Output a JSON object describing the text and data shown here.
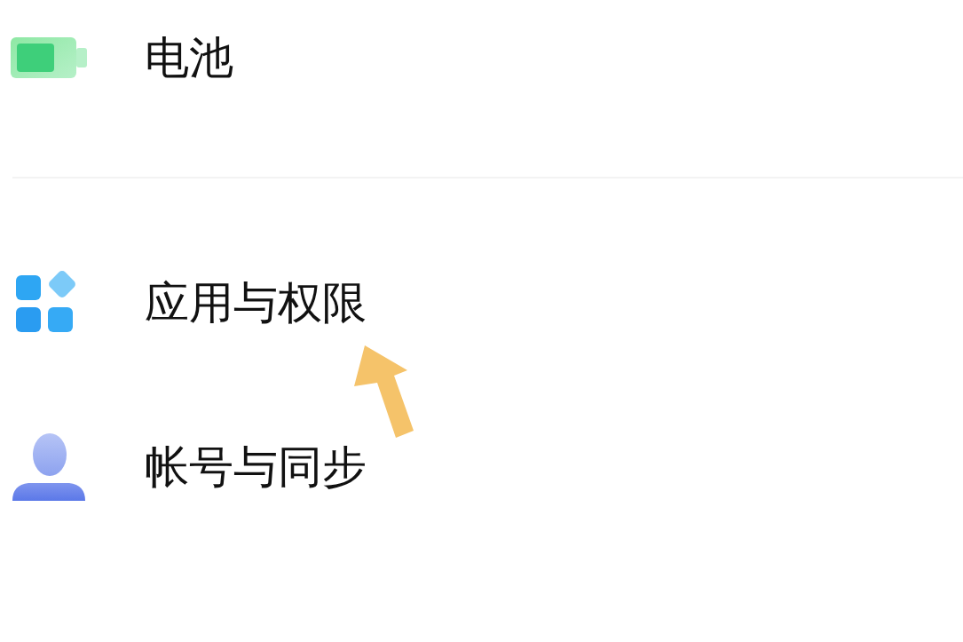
{
  "sections": [
    {
      "items": [
        {
          "kind": "battery",
          "label": "电池"
        }
      ]
    },
    {
      "items": [
        {
          "kind": "apps",
          "label": "应用与权限"
        },
        {
          "kind": "account",
          "label": "帐号与同步"
        }
      ]
    }
  ]
}
